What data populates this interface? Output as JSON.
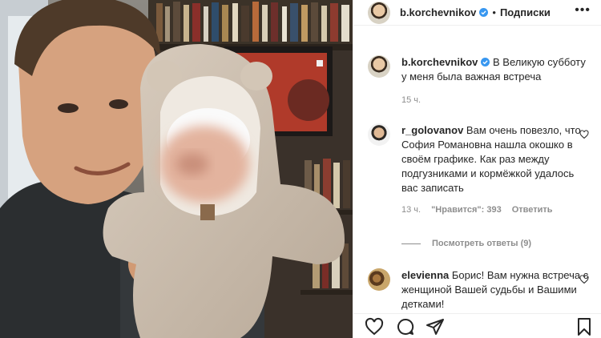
{
  "header": {
    "username": "b.korchevnikov",
    "separator": "•",
    "follow_label": "Подписки",
    "more_label": "•••"
  },
  "caption": {
    "username": "b.korchevnikov",
    "text": "В Великую субботу у меня была важная встреча",
    "time": "15 ч."
  },
  "comments": [
    {
      "username": "r_golovanov",
      "text": "Вам очень повезло, что София Романовна нашла окошко в своём графике. Как раз между подгузниками и кормёжкой удалось вас записать",
      "time": "13 ч.",
      "likes": "\"Нравится\": 393",
      "reply": "Ответить",
      "view_replies": "Посмотреть ответы (9)"
    },
    {
      "username": "elevienna",
      "text": "Борис! Вам нужна встреча с женщиной Вашей судьбы и Вашими детками!"
    }
  ],
  "icons": {
    "verified": "verified-badge-icon",
    "like": "heart-icon",
    "comment": "comment-bubble-icon",
    "share": "paper-plane-icon",
    "save": "bookmark-icon"
  },
  "colors": {
    "verified": "#3897f0",
    "text": "#262626",
    "muted": "#8e8e8e",
    "border": "#efefef"
  }
}
